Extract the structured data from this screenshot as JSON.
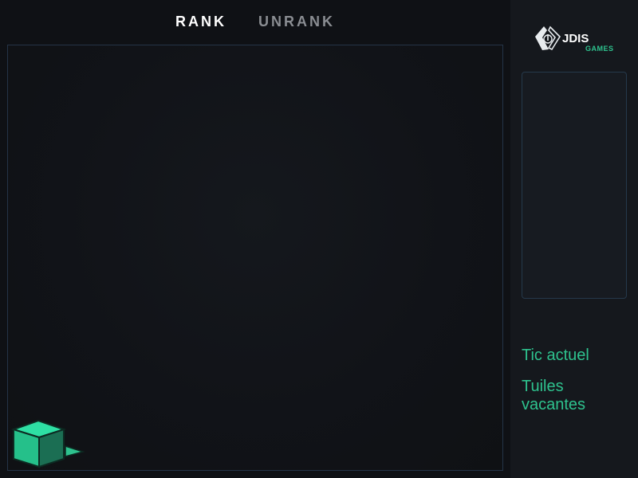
{
  "tabs": [
    {
      "label": "RANK",
      "active": true
    },
    {
      "label": "UNRANK",
      "active": false
    }
  ],
  "logo": {
    "primary": "JDIS",
    "secondary": "GAMES"
  },
  "stats": {
    "current_tick_label": "Tic actuel",
    "vacant_tiles_label": "Tuiles vacantes"
  },
  "colors": {
    "background": "#0f1115",
    "panel": "#15181d",
    "accent": "#2ec28e",
    "board_border": "#243447"
  },
  "icons": {
    "logo": "jdis-games-logo",
    "agent": "green-cube-agent"
  }
}
